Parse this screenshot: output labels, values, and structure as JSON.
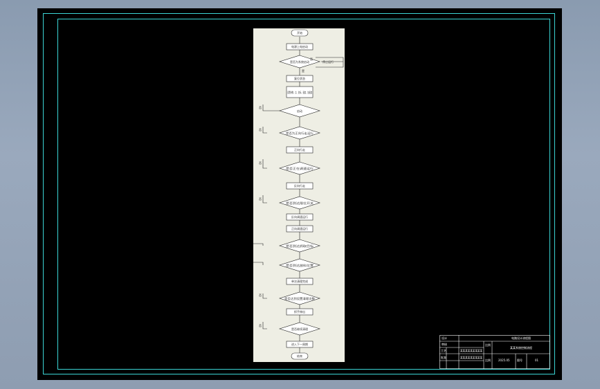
{
  "flowchart": {
    "start": "开始",
    "end": "结束",
    "steps": [
      "电源上电启动",
      "复位状态",
      "设置参数、点、坐标、速度、加速度",
      "启动",
      "正向行走",
      "反向行走",
      "反向调速运行",
      "正向调速运行",
      "单次清理完成",
      "抓手伸出",
      "抓手复位",
      "进入下一周期"
    ],
    "decisions": [
      "是否为系统启动",
      "启动",
      "是否为正向行走运行",
      "是否正在调速运行",
      "是否到达限位开关",
      "是否到达抓取目标",
      "是否到达放料位置",
      "是否达到设置清理次数",
      "是否继续清理"
    ],
    "side_box": "停止运行",
    "edge_labels": {
      "yes": "是",
      "no": "否"
    }
  },
  "title_block": {
    "drawing_title": "电路设计流程图",
    "row1_left": "设计",
    "row2_left": "审核",
    "row2_mid": "比例",
    "row2_right": "某某系统控制流程",
    "row3_left": "工艺",
    "row3_mid": "某某某某某某某某某",
    "row4_left": "批准",
    "row4_mid": "某某某某某某某某某",
    "scale_label": "比例",
    "date": "2025.05",
    "sheet_label": "图号",
    "sheet_no": "01"
  }
}
